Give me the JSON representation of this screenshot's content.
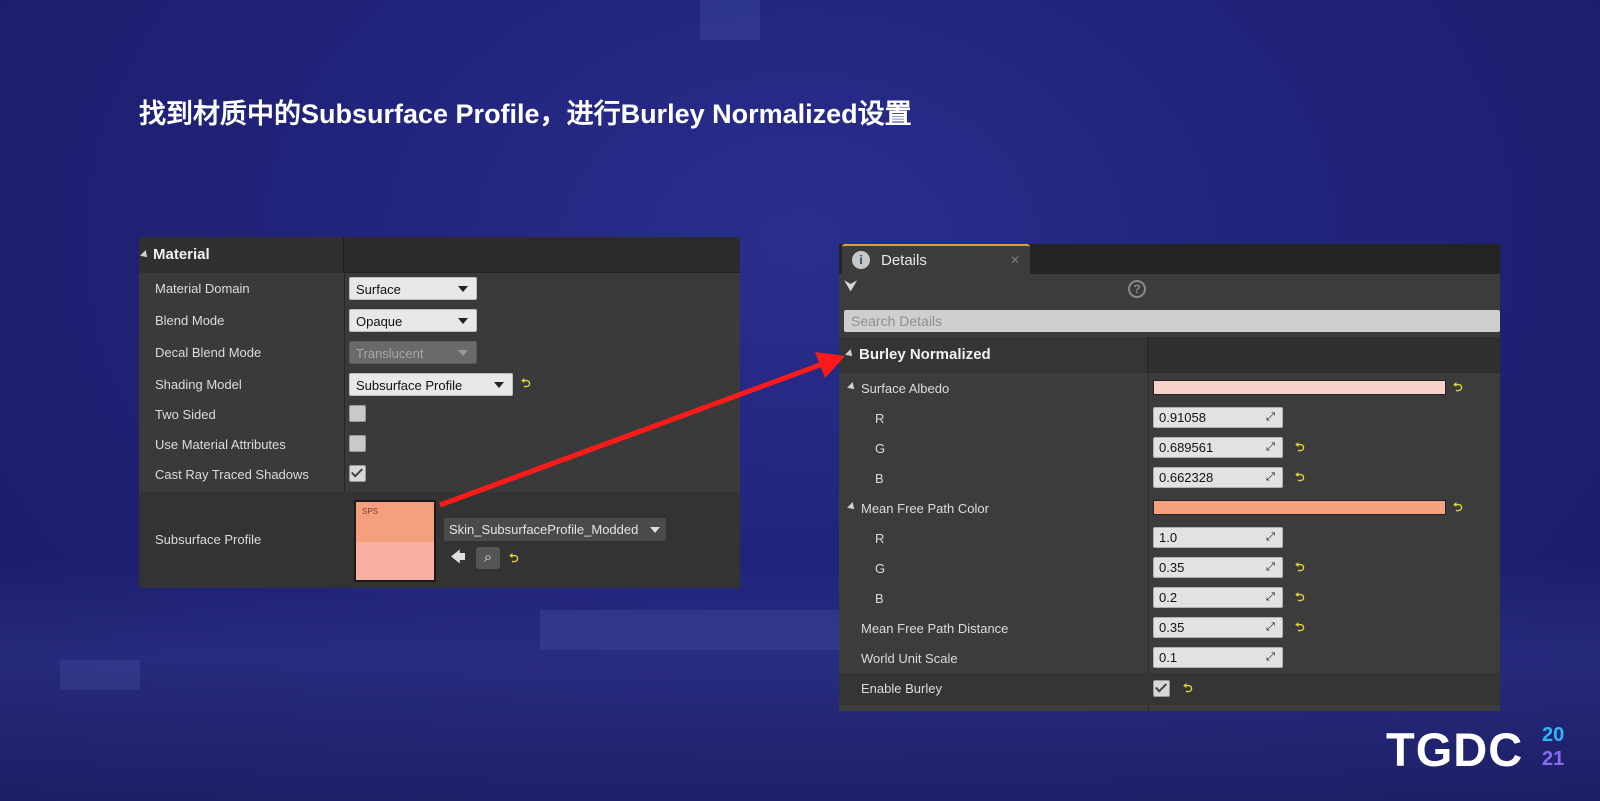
{
  "slide": {
    "title": "找到材质中的Subsurface Profile，进行Burley Normalized设置"
  },
  "material_panel": {
    "header": "Material",
    "rows": {
      "material_domain": {
        "label": "Material Domain",
        "value": "Surface"
      },
      "blend_mode": {
        "label": "Blend Mode",
        "value": "Opaque"
      },
      "decal_blend_mode": {
        "label": "Decal Blend Mode",
        "value": "Translucent"
      },
      "shading_model": {
        "label": "Shading Model",
        "value": "Subsurface Profile"
      },
      "two_sided": {
        "label": "Two Sided",
        "checked": false
      },
      "use_material_attributes": {
        "label": "Use Material Attributes",
        "checked": false
      },
      "cast_ray_traced_shadows": {
        "label": "Cast Ray Traced Shadows",
        "checked": true
      },
      "subsurface_profile": {
        "label": "Subsurface Profile",
        "asset": "Skin_SubsurfaceProfile_Modded",
        "thumb_tag": "SPS"
      }
    },
    "thumb_colors": {
      "top": "#f59f7e",
      "bottom": "#f8b0a2"
    }
  },
  "details_panel": {
    "tab_label": "Details",
    "search_placeholder": "Search Details",
    "category": "Burley Normalized",
    "surface_albedo": {
      "label": "Surface Albedo",
      "color": "#f9d1cb",
      "r": "0.91058",
      "g": "0.689561",
      "b": "0.662328"
    },
    "mean_free_path_color": {
      "label": "Mean Free Path Color",
      "color": "#f6a27e",
      "r": "1.0",
      "g": "0.35",
      "b": "0.2"
    },
    "channel_labels": {
      "r": "R",
      "g": "G",
      "b": "B"
    },
    "mean_free_path_distance": {
      "label": "Mean Free Path Distance",
      "value": "0.35"
    },
    "world_unit_scale": {
      "label": "World Unit Scale",
      "value": "0.1"
    },
    "enable_burley": {
      "label": "Enable Burley",
      "checked": true
    }
  },
  "logo": {
    "text": "TGDC",
    "year_top": "20",
    "year_bottom": "21"
  },
  "colors": {
    "reset_icon": "#e6d23a",
    "arrow": "#ff1a1a",
    "tab_accent": "#d4a436"
  }
}
